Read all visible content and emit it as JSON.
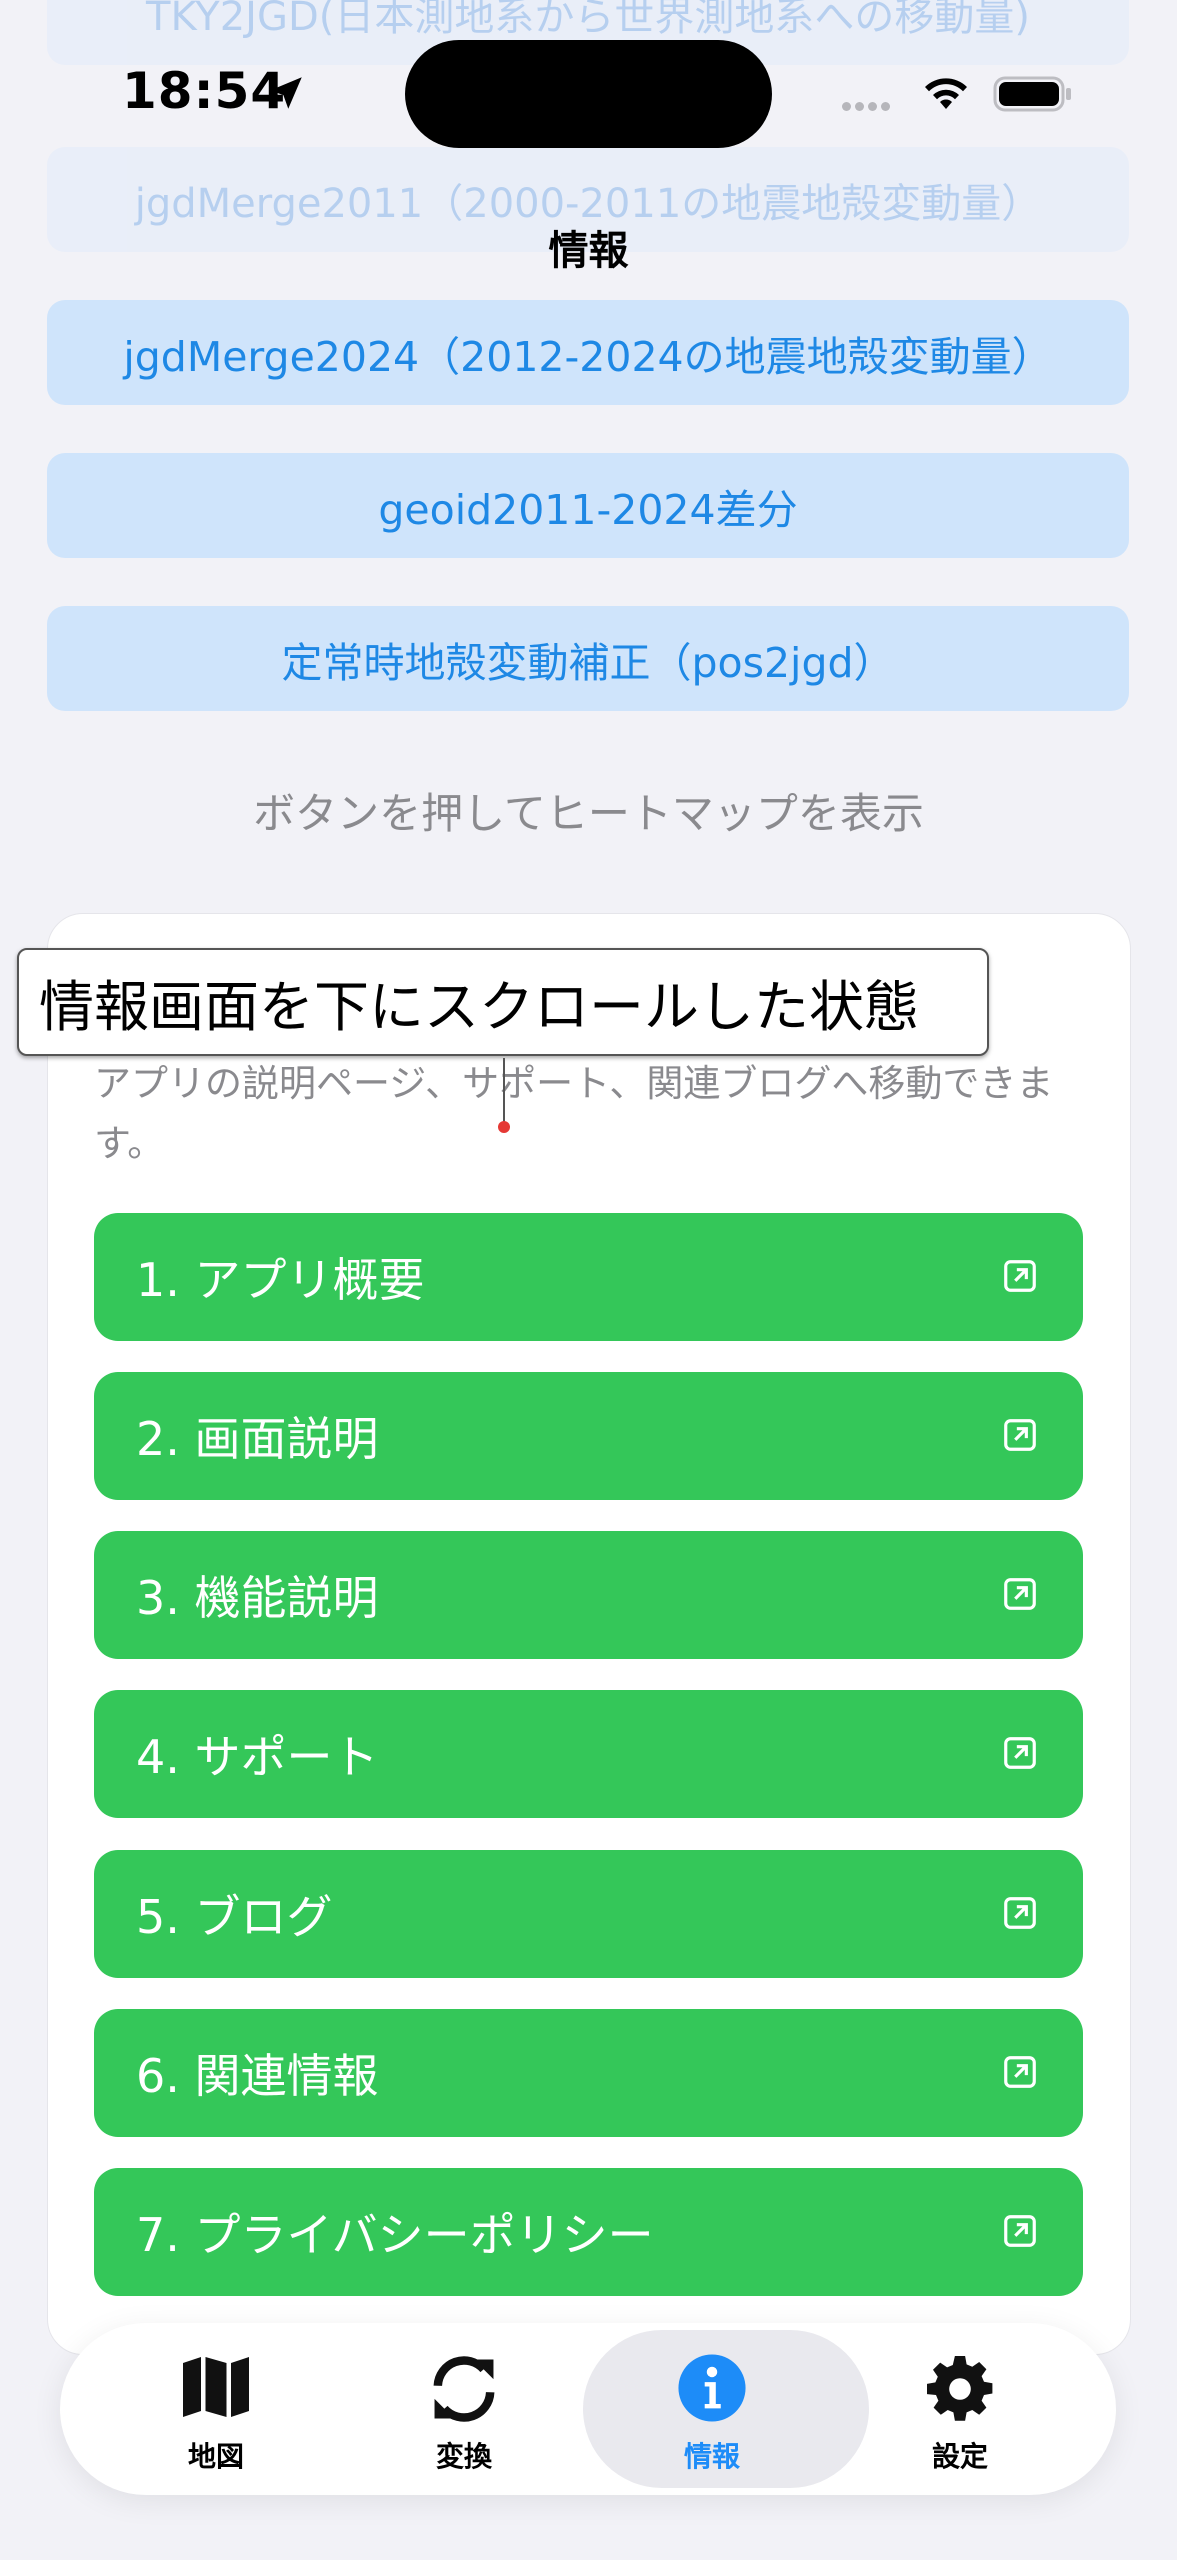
{
  "status_bar": {
    "time": "18:54"
  },
  "nav": {
    "title": "情報"
  },
  "faded_buttons": [
    "TKY2JGD(日本測地系から世界測地系への移動量)",
    "jgdMerge2011（2000-2011の地震地殻変動量）"
  ],
  "heatmap_buttons": [
    "jgdMerge2024（2012-2024の地震地殻変動量）",
    "geoid2011-2024差分",
    "定常時地殻変動補正（pos2jgd）"
  ],
  "hint": "ボタンを押してヒートマップを表示",
  "overlay": {
    "label": "情報画面を下にスクロールした状態"
  },
  "card": {
    "description": "アプリの説明ページ、サポート、関連ブログへ移動できます。",
    "links": [
      "1. アプリ概要",
      "2. 画面説明",
      "3. 機能説明",
      "4. サポート",
      "5. ブログ",
      "6. 関連情報",
      "7. プライバシーポリシー"
    ]
  },
  "tabs": [
    {
      "label": "地図",
      "icon": "map-icon"
    },
    {
      "label": "変換",
      "icon": "convert-icon"
    },
    {
      "label": "情報",
      "icon": "info-icon",
      "active": true
    },
    {
      "label": "設定",
      "icon": "gear-icon"
    }
  ],
  "colors": {
    "accent": "#1d8cf8",
    "green": "#34c759",
    "light_blue": "#cfe4fb"
  }
}
